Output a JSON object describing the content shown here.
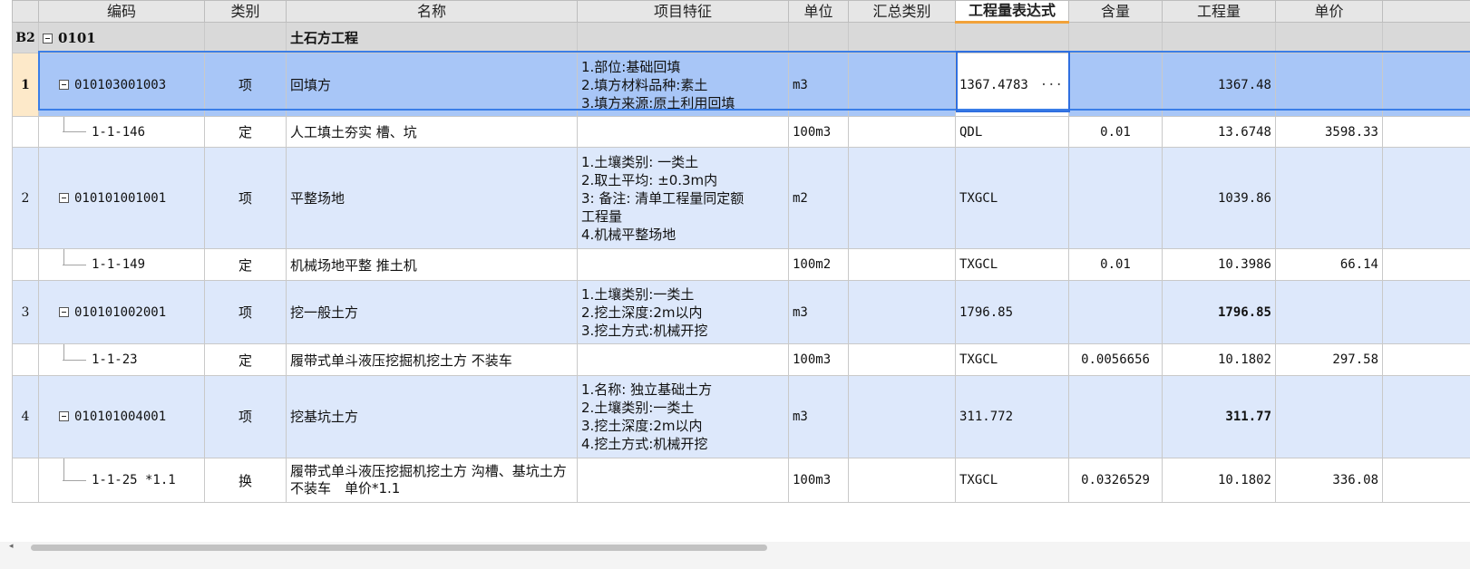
{
  "columns": {
    "code": "编码",
    "type": "类别",
    "name": "名称",
    "feature": "项目特征",
    "unit": "单位",
    "summary": "汇总类别",
    "expr": "工程量表达式",
    "content": "含量",
    "qty": "工程量",
    "price": "单价"
  },
  "section": {
    "tag": "B2",
    "code": "0101",
    "name": "土石方工程"
  },
  "rows": [
    {
      "no": "1",
      "code": "010103001003",
      "type": "项",
      "name": "回填方",
      "feature": "1.部位:基础回填\n2.填方材料品种:素土\n3.填方来源:原土利用回填",
      "unit": "m3",
      "expr": "1367.4783",
      "content": "",
      "qty": "1367.48",
      "price": ""
    },
    {
      "no": "",
      "code": "1-1-146",
      "type": "定",
      "name": "人工填土夯实 槽、坑",
      "feature": "",
      "unit": "100m3",
      "expr": "QDL",
      "content": "0.01",
      "qty": "13.6748",
      "price": "3598.33"
    },
    {
      "no": "2",
      "code": "010101001001",
      "type": "项",
      "name": "平整场地",
      "feature": "1.土壤类别: 一类土\n2.取土平均: ±0.3m内\n3: 备注: 清单工程量同定额\n工程量\n4.机械平整场地",
      "unit": "m2",
      "expr": "TXGCL",
      "content": "",
      "qty": "1039.86",
      "price": ""
    },
    {
      "no": "",
      "code": "1-1-149",
      "type": "定",
      "name": "机械场地平整 推土机",
      "feature": "",
      "unit": "100m2",
      "expr": "TXGCL",
      "content": "0.01",
      "qty": "10.3986",
      "price": "66.14"
    },
    {
      "no": "3",
      "code": "010101002001",
      "type": "项",
      "name": "挖一般土方",
      "feature": "1.土壤类别:一类土\n2.挖土深度:2m以内\n3.挖土方式:机械开挖",
      "unit": "m3",
      "expr": "1796.85",
      "content": "",
      "qty": "1796.85",
      "price": ""
    },
    {
      "no": "",
      "code": "1-1-23",
      "type": "定",
      "name": "履带式单斗液压挖掘机挖土方 不装车",
      "feature": "",
      "unit": "100m3",
      "expr": "TXGCL",
      "content": "0.0056656",
      "qty": "10.1802",
      "price": "297.58"
    },
    {
      "no": "4",
      "code": "010101004001",
      "type": "项",
      "name": "挖基坑土方",
      "feature": "1.名称: 独立基础土方\n2.土壤类别:一类土\n3.挖土深度:2m以内\n4.挖土方式:机械开挖",
      "unit": "m3",
      "expr": "311.772",
      "content": "",
      "qty": "311.77",
      "price": ""
    },
    {
      "no": "",
      "code": "1-1-25 *1.1",
      "type": "换",
      "name": "履带式单斗液压挖掘机挖土方 沟槽、基坑土方 不装车　单价*1.1",
      "feature": "",
      "unit": "100m3",
      "expr": "TXGCL",
      "content": "0.0326529",
      "qty": "10.1802",
      "price": "336.08"
    }
  ],
  "icons": {
    "collapse": "collapse-minus-icon",
    "ellipsis": "ellipsis-icon"
  },
  "colors": {
    "selected_row": "#a8c6f7",
    "bill_row": "#dde8fb",
    "section_row": "#d9d9d9",
    "selection_border": "#3a7ee8",
    "active_header_underline": "#f2a23a"
  }
}
